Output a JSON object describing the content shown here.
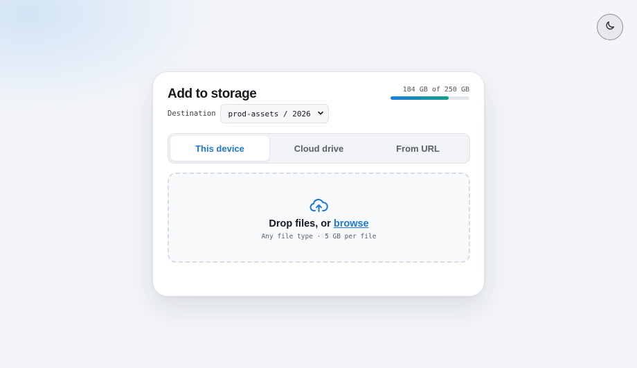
{
  "theme_toggle": {
    "icon": "moon-icon"
  },
  "card": {
    "title": "Add to storage",
    "quota": {
      "text": "184 GB of 250 GB",
      "used_gb": 184,
      "total_gb": 250
    },
    "destination": {
      "label": "Destination",
      "value": "prod-assets / 2026"
    },
    "tabs": [
      {
        "label": "This device",
        "active": true
      },
      {
        "label": "Cloud drive",
        "active": false
      },
      {
        "label": "From URL",
        "active": false
      }
    ],
    "dropzone": {
      "icon": "cloud-upload-icon",
      "prompt": "Drop files, or",
      "link": "browse",
      "hint": "Any file type · 5 GB per file"
    }
  },
  "colors": {
    "accent": "#1c78d6",
    "quota_start": "#1f7bd8",
    "quota_end": "#13a08a"
  }
}
